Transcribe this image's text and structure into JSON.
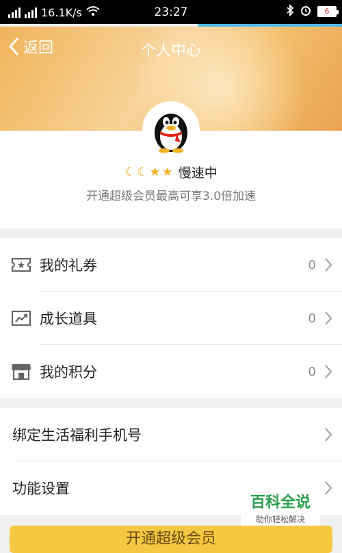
{
  "status_bar": {
    "network_speed": "16.1K/s",
    "time": "23:27",
    "battery": "6",
    "icons": [
      "signal-icon",
      "signal-icon",
      "wifi-icon",
      "bluetooth-icon",
      "alarm-icon",
      "battery-icon"
    ]
  },
  "header": {
    "back_label": "返回",
    "title": "个人中心"
  },
  "profile": {
    "status": "慢速中",
    "subtitle": "开通超级会员最高可享3.0倍加速",
    "level_icons": [
      "moon-icon",
      "moon-icon",
      "star-icon",
      "star-icon"
    ]
  },
  "menu_group_1": [
    {
      "label": "我的礼券",
      "count": "0",
      "icon": "ticket-icon"
    },
    {
      "label": "成长道具",
      "count": "0",
      "icon": "growth-chart-icon"
    },
    {
      "label": "我的积分",
      "count": "0",
      "icon": "store-icon"
    }
  ],
  "menu_group_2": [
    {
      "label": "绑定生活福利手机号"
    },
    {
      "label": "功能设置"
    }
  ],
  "vip_button": {
    "label": "开通超级会员"
  },
  "watermark": {
    "title": "百科全说",
    "subtitle": "助你轻松解决"
  },
  "colors": {
    "accent": "#f0b45b",
    "vip": "#f5c842",
    "watermark_green": "#2aa14b"
  }
}
